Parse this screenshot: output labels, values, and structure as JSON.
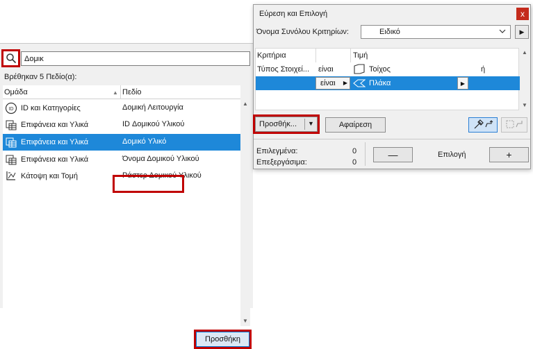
{
  "search": {
    "value": "Δομικ",
    "found_text": "Βρέθηκαν 5 Πεδίο(α):"
  },
  "list": {
    "headers": {
      "group": "Ομάδα",
      "field": "Πεδίο"
    },
    "rows": [
      {
        "group": "ID και Κατηγορίες",
        "field": "Δομική Λειτουργία",
        "icon": "id-icon"
      },
      {
        "group": "Επιφάνεια και Υλικά",
        "field": "ID Δομικού Υλικού",
        "icon": "material-icon"
      },
      {
        "group": "Επιφάνεια και Υλικά",
        "field": "Δομικό Υλικό",
        "icon": "material-icon"
      },
      {
        "group": "Επιφάνεια και Υλικά",
        "field": "Όνομα Δομικού Υλικού",
        "icon": "material-icon"
      },
      {
        "group": "Κάτοψη και Τομή",
        "field": "Ράστερ Δομικού Υλικού",
        "icon": "plan-section-icon"
      }
    ],
    "selected_index": 2
  },
  "add_button_label": "Προσθήκη",
  "dialog": {
    "title": "Εύρεση και Επιλογή",
    "criteria_set_label": "Όνομα Συνόλου Κριτηρίων:",
    "criteria_set_value": "Ειδικό",
    "table_headers": {
      "criteria": "Κριτήρια",
      "value": "Τιμή"
    },
    "rows": [
      {
        "criteria": "Τύπος Στοιχεί...",
        "operator": "είναι",
        "value": "Τοίχος",
        "logic": "ή"
      },
      {
        "criteria": "",
        "operator": "είναι",
        "value": "Πλάκα",
        "logic": ""
      }
    ],
    "add_dropdown_label": "Προσθήκ...",
    "remove_label": "Αφαίρεση",
    "selected_label": "Επιλεγμένα:",
    "selected_count": "0",
    "editable_label": "Επεξεργάσιμα:",
    "editable_count": "0",
    "selection_label": "Επιλογή",
    "minus_label": "—",
    "plus_label": "+",
    "close_label": "x"
  },
  "colors": {
    "selection": "#1e88d9",
    "highlight_border": "#c00000",
    "panel_bg": "#f0f0f0"
  }
}
